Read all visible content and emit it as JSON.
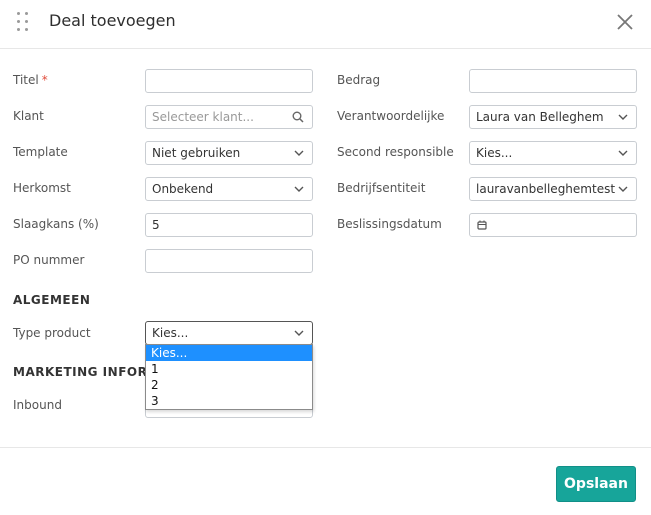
{
  "header": {
    "title": "Deal toevoegen",
    "drag_icon": "drag-handle-icon",
    "close_icon": "close-icon"
  },
  "left": {
    "titel": {
      "label": "Titel",
      "required_mark": "*",
      "value": ""
    },
    "klant": {
      "label": "Klant",
      "placeholder": "Selecteer klant..."
    },
    "template": {
      "label": "Template",
      "value": "Niet gebruiken"
    },
    "herkomst": {
      "label": "Herkomst",
      "value": "Onbekend"
    },
    "slaagkans": {
      "label": "Slaagkans (%)",
      "value": "5"
    },
    "po_nummer": {
      "label": "PO nummer",
      "value": ""
    }
  },
  "right": {
    "bedrag": {
      "label": "Bedrag",
      "value": ""
    },
    "verantwoordelijke": {
      "label": "Verantwoordelijke",
      "value": "Laura van Belleghem"
    },
    "second_responsible": {
      "label": "Second responsible",
      "value": "Kies..."
    },
    "bedrijfsentiteit": {
      "label": "Bedrijfsentiteit",
      "value": "lauravanbelleghemtest"
    },
    "beslissingsdatum": {
      "label": "Beslissingsdatum",
      "value": ""
    }
  },
  "algemeen": {
    "heading": "ALGEMEEN",
    "type_product": {
      "label": "Type product",
      "value": "Kies...",
      "options": [
        "Kies...",
        "1",
        "2",
        "3"
      ],
      "selected_index": 0
    }
  },
  "marketing": {
    "heading": "MARKETING INFORM",
    "inbound": {
      "label": "Inbound"
    }
  },
  "footer": {
    "save_label": "Opslaan"
  },
  "colors": {
    "accent": "#17a59a",
    "required": "#e04b3a",
    "selected_option": "#1e90ff"
  }
}
